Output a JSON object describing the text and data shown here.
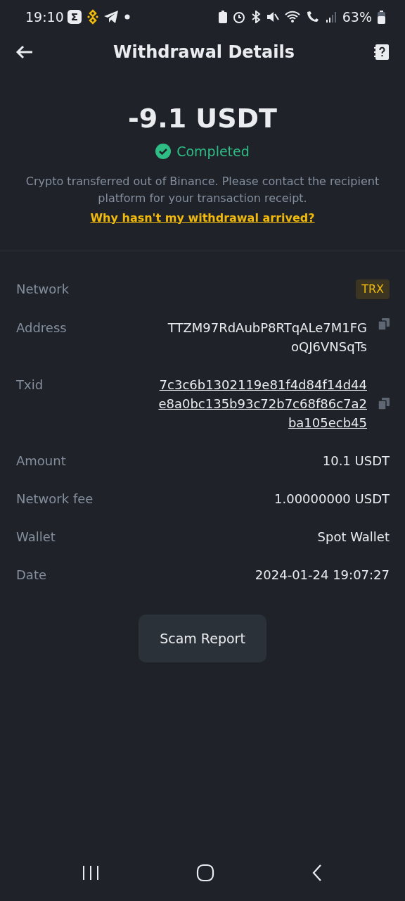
{
  "status_bar": {
    "time": "19:10",
    "battery": "63%"
  },
  "header": {
    "title": "Withdrawal Details"
  },
  "summary": {
    "amount": "-9.1 USDT",
    "status": "Completed",
    "notice": "Crypto transferred out of Binance. Please contact the recipient platform for your transaction receipt.",
    "help_link": "Why hasn't my withdrawal arrived?"
  },
  "details": [
    {
      "kind": "badge",
      "label": "Network",
      "value_lines": [
        "TRX"
      ]
    },
    {
      "kind": "copy",
      "label": "Address",
      "value_lines": [
        "TTZM97RdAubP8RTqALe7M1FG",
        "oQJ6VNSqTs"
      ]
    },
    {
      "kind": "link-copy",
      "label": "Txid",
      "value_lines": [
        "7c3c6b1302119e81f4d84f14d44",
        "e8a0bc135b93c72b7c68f86c7a2",
        "ba105ecb45"
      ]
    },
    {
      "kind": "text",
      "label": "Amount",
      "value_lines": [
        "10.1 USDT"
      ]
    },
    {
      "kind": "text",
      "label": "Network fee",
      "value_lines": [
        "1.00000000 USDT"
      ]
    },
    {
      "kind": "text",
      "label": "Wallet",
      "value_lines": [
        "Spot Wallet"
      ]
    },
    {
      "kind": "text",
      "label": "Date",
      "value_lines": [
        "2024-01-24 19:07:27"
      ]
    }
  ],
  "button": "Scam Report"
}
